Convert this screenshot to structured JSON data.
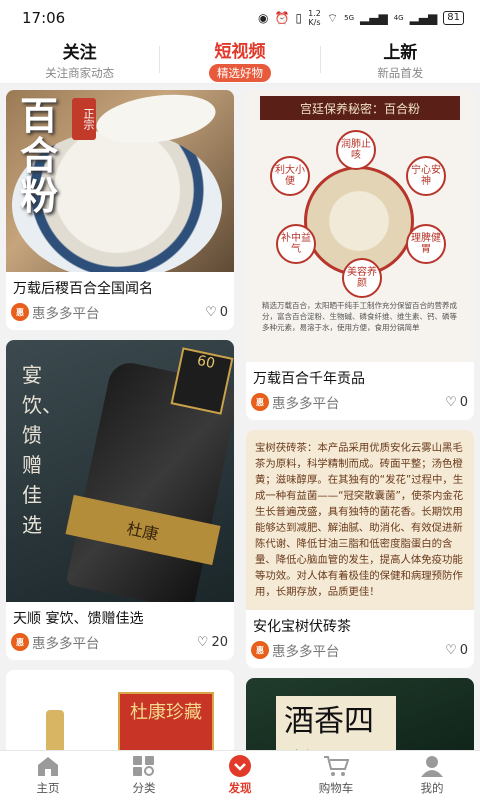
{
  "status": {
    "time": "17:06",
    "speed_top": "1.2",
    "speed_unit": "K/s",
    "battery": "81",
    "net1": "5G",
    "net2": "4G"
  },
  "top_tabs": [
    {
      "title": "关注",
      "subtitle": "关注商家动态",
      "active": false
    },
    {
      "title": "短视频",
      "subtitle": "精选好物",
      "active": true
    },
    {
      "title": "上新",
      "subtitle": "新品首发",
      "active": false
    }
  ],
  "feed": {
    "left": [
      {
        "title": "万载后稷百合全国闻名",
        "shop": "惠多多平台",
        "likes": "0",
        "image_text": {
          "big": "百合粉",
          "seal": "正宗"
        }
      },
      {
        "title": "天顺 宴饮、馈赠佳选",
        "shop": "惠多多平台",
        "likes": "20",
        "image_text": {
          "vertical": "宴饮、馈赠佳选",
          "cap": "60",
          "label": "杜康"
        }
      },
      {
        "title": "",
        "shop": "",
        "likes": "",
        "image_text": {
          "box": "杜康珍藏"
        }
      }
    ],
    "right": [
      {
        "title": "万载百合千年贡品",
        "shop": "惠多多平台",
        "likes": "0",
        "image_text": {
          "header": "宫廷保养秘密：百合粉",
          "badges": [
            "润肺止咳",
            "宁心安神",
            "利大小便",
            "补中益气",
            "理脾健胃",
            "美容养颜"
          ],
          "desc": "精选万载百合，太阳晒干纯手工制作充分保留百合的营养成分，富含百合淀粉、生物碱、磷食纤维、维生素、钙、磷等多种元素，易溶于水，使用方便，食用分锅简单"
        }
      },
      {
        "title": "安化宝树伏砖茶",
        "shop": "惠多多平台",
        "likes": "0",
        "image_text": {
          "desc": "宝树茯砖茶：本产品采用优质安化云雾山黑毛茶为原料，科学精制而成。砖面平整；汤色橙黄；滋味醇厚。在其独有的“发花”过程中，生成一种有益菌——“冠突散囊菌”，使茶内金花生长普遍茂盛，具有独特的菌花香。长期饮用能够达到减肥、解油腻、助消化、有效促进新陈代谢、降低甘油三脂和低密度脂蛋白的含量、降低心脑血管的发生，提高人体免疫功能等功效。对人体有着极佳的保健和病理预防作用，长期存放，品质更佳！"
        }
      },
      {
        "title": "",
        "shop": "",
        "likes": "",
        "image_text": {
          "scroll": "酒香四溢"
        }
      }
    ]
  },
  "bottom_nav": [
    {
      "label": "主页",
      "icon": "home-icon",
      "active": false
    },
    {
      "label": "分类",
      "icon": "category-icon",
      "active": false
    },
    {
      "label": "发现",
      "icon": "discover-icon",
      "active": true
    },
    {
      "label": "购物车",
      "icon": "cart-icon",
      "active": false
    },
    {
      "label": "我的",
      "icon": "user-icon",
      "active": false
    }
  ],
  "colors": {
    "accent": "#e13a2a",
    "shop_logo": "#e85f1c"
  }
}
